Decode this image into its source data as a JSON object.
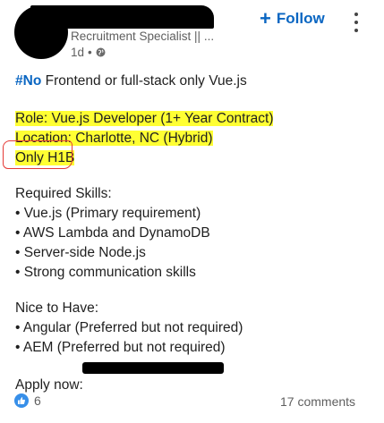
{
  "header": {
    "subtitle": "Recruitment Specialist || ...",
    "time": "1d",
    "separator": "•",
    "follow_plus": "+",
    "follow_label": "Follow",
    "globe_icon": "globe-icon",
    "more_icon": "more-vertical-icon"
  },
  "post": {
    "line1_hashtag": "#No",
    "line1_rest": " Frontend or full-stack only Vue.js",
    "role": "Role: Vue.js Developer (1+ Year Contract)",
    "location": "Location: Charlotte, NC (Hybrid)",
    "visa": "Only H1B",
    "required_heading": "Required Skills:",
    "required_skills": [
      "• Vue.js (Primary requirement)",
      "• AWS Lambda and DynamoDB",
      "• Server-side Node.js",
      "• Strong communication skills"
    ],
    "nice_heading": "Nice to Have:",
    "nice_skills": [
      "• Angular (Preferred but not required)",
      "• AEM (Preferred but not required)"
    ],
    "apply_label": "Apply now:"
  },
  "footer": {
    "reaction_count": "6",
    "comments": "17 comments",
    "like_icon": "like-icon"
  },
  "colors": {
    "accent": "#0a66c2",
    "highlight": "#ffff33",
    "annotation": "#e53935"
  }
}
